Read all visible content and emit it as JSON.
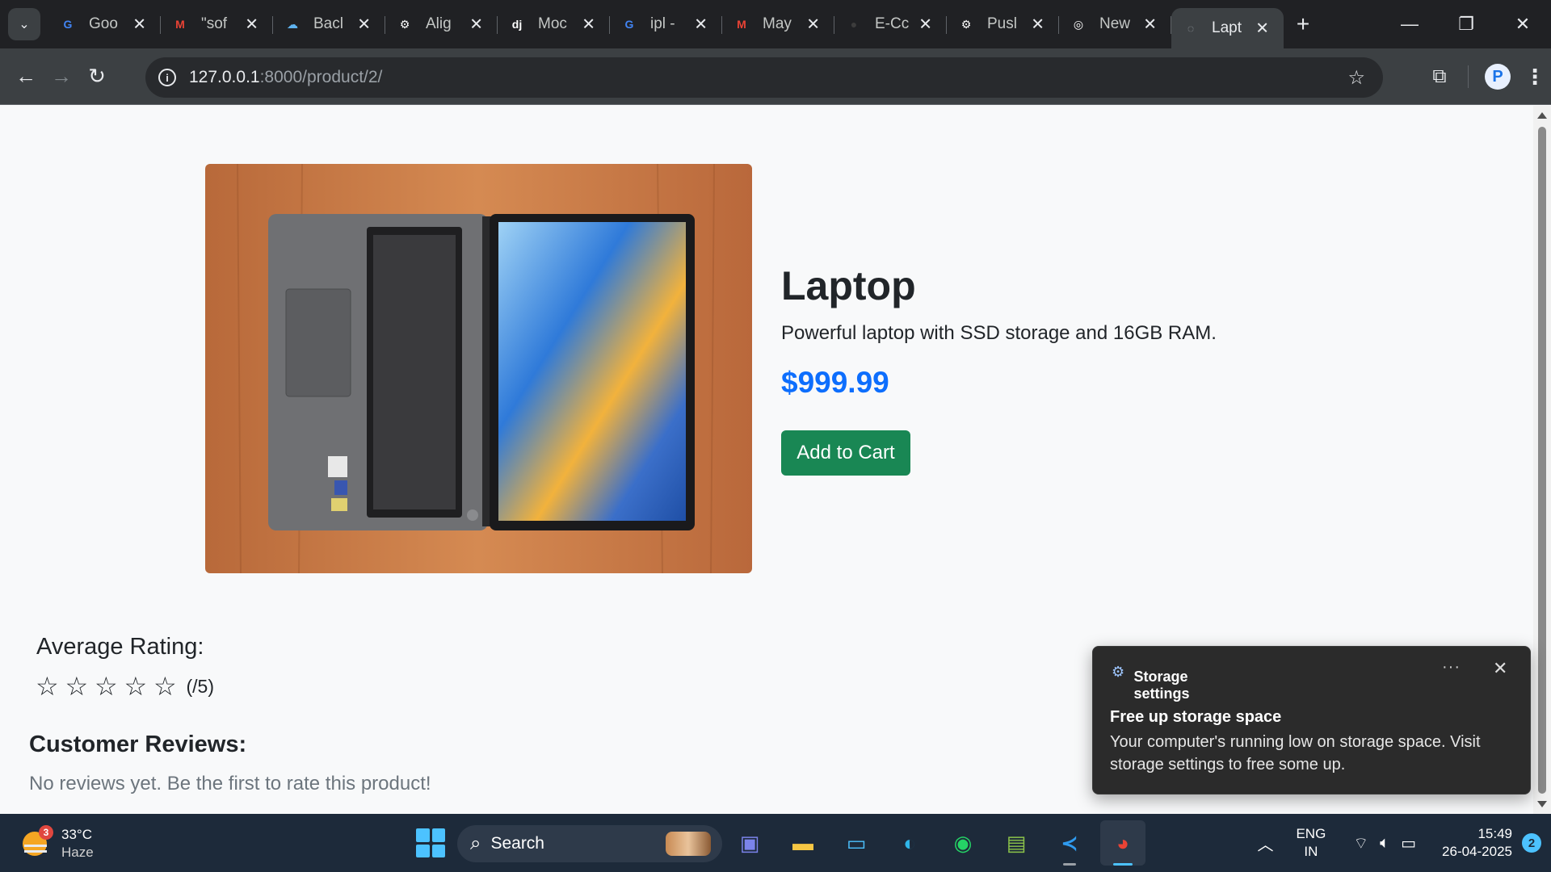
{
  "browser": {
    "tabs": [
      {
        "title": "Goo",
        "favicon": "google-icon",
        "color": "#4285f4"
      },
      {
        "title": "\"sof",
        "favicon": "gmail-icon",
        "color": "#ea4335"
      },
      {
        "title": "Bacl",
        "favicon": "cloud-icon",
        "color": "#5fb3f0"
      },
      {
        "title": "Alig",
        "favicon": "chatgpt-icon",
        "color": "#ffffff"
      },
      {
        "title": "Moc",
        "favicon": "django-icon",
        "color": "#ffffff"
      },
      {
        "title": "ipl -",
        "favicon": "google-icon",
        "color": "#4285f4"
      },
      {
        "title": "May",
        "favicon": "gmail-icon",
        "color": "#ea4335"
      },
      {
        "title": "E-Cc",
        "favicon": "github-icon",
        "color": "#3c3c3c"
      },
      {
        "title": "Pusl",
        "favicon": "chatgpt-icon",
        "color": "#ffffff"
      },
      {
        "title": "New",
        "favicon": "chrome-icon",
        "color": "#ffffff"
      },
      {
        "title": "Lapt",
        "favicon": "globe-icon",
        "color": "#9aa0a6",
        "active": true
      }
    ],
    "url_host": "127.0.0.1",
    "url_path": ":8000/product/2/"
  },
  "product": {
    "title": "Laptop",
    "description": "Powerful laptop with SSD storage and 16GB RAM.",
    "price": "$999.99",
    "add_to_cart": "Add to Cart"
  },
  "ratings": {
    "average_label": "Average Rating:",
    "stars_filled": 0,
    "stars_total": 5,
    "suffix": "(/5)"
  },
  "reviews": {
    "title": "Customer Reviews:",
    "empty_text": "No reviews yet. Be the first to rate this product!"
  },
  "toast": {
    "app": "Storage settings",
    "heading": "Free up storage space",
    "body": "Your computer's running low on storage space. Visit storage settings to free some up."
  },
  "taskbar": {
    "weather_badge": "3",
    "temperature": "33°C",
    "condition": "Haze",
    "search": "Search",
    "lang_top": "ENG",
    "lang_bottom": "IN",
    "time": "15:49",
    "date": "26-04-2025",
    "notifications": "2"
  },
  "colors": {
    "price": "#0d6efd",
    "add_to_cart_bg": "#198754",
    "accent": "#4cc2ff"
  }
}
